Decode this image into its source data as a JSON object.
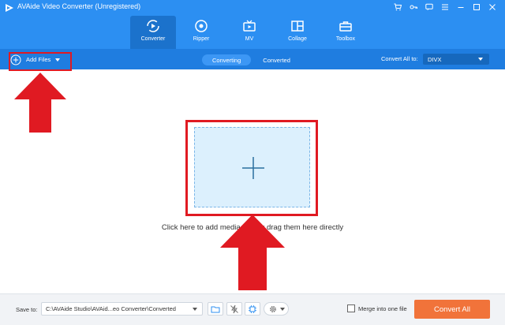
{
  "app": {
    "title": "AVAide Video Converter (Unregistered)"
  },
  "window_controls": [
    "cart-icon",
    "key-icon",
    "chat-icon",
    "menu-icon",
    "minimize-icon",
    "maximize-icon",
    "close-icon"
  ],
  "nav": {
    "tabs": [
      {
        "label": "Converter",
        "icon": "converter-icon",
        "active": true
      },
      {
        "label": "Ripper",
        "icon": "disc-icon",
        "active": false
      },
      {
        "label": "MV",
        "icon": "tv-icon",
        "active": false
      },
      {
        "label": "Collage",
        "icon": "collage-icon",
        "active": false
      },
      {
        "label": "Toolbox",
        "icon": "toolbox-icon",
        "active": false
      }
    ]
  },
  "toolbar": {
    "add_files_label": "Add Files",
    "modes": [
      {
        "label": "Converting",
        "active": true
      },
      {
        "label": "Converted",
        "active": false
      }
    ],
    "convert_all_to_label": "Convert All to:",
    "format_value": "DIVX"
  },
  "main": {
    "drop_hint": "Click here to add media files or drag them here directly"
  },
  "bottom": {
    "save_to_label": "Save to:",
    "path_value": "C:\\AVAide Studio\\AVAid...eo Converter\\Converted",
    "merge_label": "Merge into one file",
    "convert_all_label": "Convert All"
  },
  "colors": {
    "topbar": "#2c8ff2",
    "subbar": "#1f7de0",
    "highlight": "#e01a22",
    "convert_button": "#f1733a",
    "dropzone": "#dcf0fd"
  }
}
